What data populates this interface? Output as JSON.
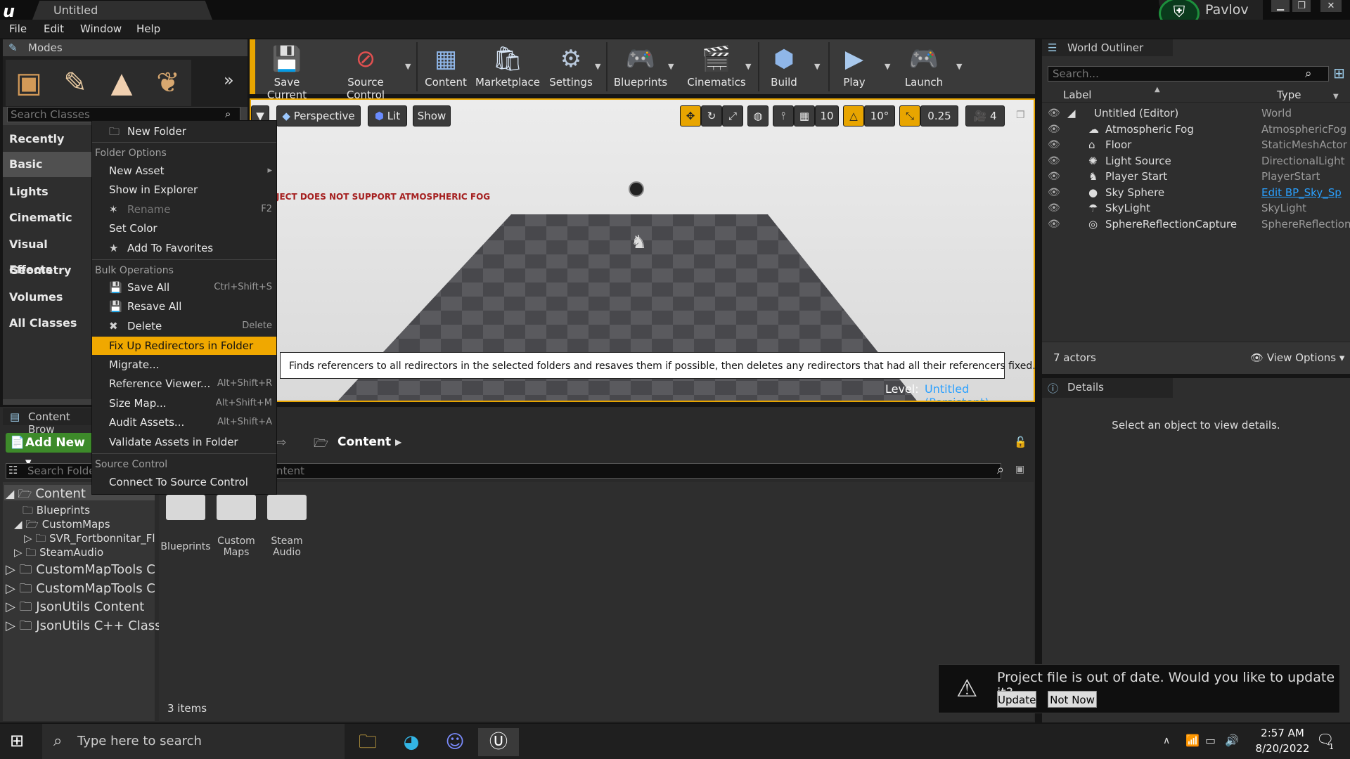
{
  "window": {
    "tab_title": "Untitled",
    "user_name": "Pavlov"
  },
  "menu": [
    "File",
    "Edit",
    "Window",
    "Help"
  ],
  "modes": {
    "tab_label": "Modes",
    "search_placeholder": "Search Classes",
    "categories": [
      "Recently Placed",
      "Basic",
      "Lights",
      "Cinematic",
      "Visual Effects",
      "Geometry",
      "Volumes",
      "All Classes"
    ]
  },
  "toolbar": {
    "buttons": [
      "Save Current",
      "Source Control",
      "Content",
      "Marketplace",
      "Settings",
      "Blueprints",
      "Cinematics",
      "Build",
      "Play",
      "Launch"
    ]
  },
  "viewport": {
    "perspective": "Perspective",
    "lit": "Lit",
    "show": "Show",
    "grid_snap": "10",
    "rot_snap": "10°",
    "scale_snap": "0.25",
    "cam_speed": "4",
    "error_text": "JECT DOES NOT SUPPORT ATMOSPHERIC FOG",
    "level_label": "Level:",
    "level_value": "Untitled (Persistent)"
  },
  "tooltip": "Finds referencers to all redirectors in the selected folders and resaves them if possible, then deletes any redirectors that had all their referencers fixed.",
  "context_menu": {
    "new_folder": "New Folder",
    "section_folder_options": "Folder Options",
    "new_asset": "New Asset",
    "show_in_explorer": "Show in Explorer",
    "rename": "Rename",
    "rename_sc": "F2",
    "set_color": "Set Color",
    "add_to_favorites": "Add To Favorites",
    "section_bulk": "Bulk Operations",
    "save_all": "Save All",
    "save_all_sc": "Ctrl+Shift+S",
    "resave_all": "Resave All",
    "delete": "Delete",
    "delete_sc": "Delete",
    "fix_up": "Fix Up Redirectors in Folder",
    "migrate": "Migrate...",
    "reference_viewer": "Reference Viewer...",
    "reference_viewer_sc": "Alt+Shift+R",
    "size_map": "Size Map...",
    "size_map_sc": "Alt+Shift+M",
    "audit_assets": "Audit Assets...",
    "audit_assets_sc": "Alt+Shift+A",
    "validate": "Validate Assets in Folder",
    "section_source_control": "Source Control",
    "connect_sc": "Connect To Source Control"
  },
  "outliner": {
    "tab_label": "World Outliner",
    "search_placeholder": "Search...",
    "col_label": "Label",
    "col_type": "Type",
    "rows": [
      {
        "label": "Untitled (Editor)",
        "type": "World"
      },
      {
        "label": "Atmospheric Fog",
        "type": "AtmosphericFog"
      },
      {
        "label": "Floor",
        "type": "StaticMeshActor"
      },
      {
        "label": "Light Source",
        "type": "DirectionalLight"
      },
      {
        "label": "Player Start",
        "type": "PlayerStart"
      },
      {
        "label": "Sky Sphere",
        "type": "Edit BP_Sky_Sp"
      },
      {
        "label": "SkyLight",
        "type": "SkyLight"
      },
      {
        "label": "SphereReflectionCapture",
        "type": "SphereReflection"
      }
    ],
    "actor_count": "7 actors",
    "view_options": "View Options"
  },
  "details": {
    "tab_label": "Details",
    "empty_text": "Select an object to view details."
  },
  "content_browser": {
    "tab_label": "Content Brow",
    "add_new": "Add New",
    "path": "Content",
    "search_folders_placeholder": "Search Folde",
    "search_assets_placeholder": "ntent",
    "tree": [
      "Content",
      "Blueprints",
      "CustomMaps",
      "SVR_Fortbonnitar_Fl",
      "SteamAudio",
      "CustomMapTools C",
      "CustomMapTools C",
      "JsonUtils Content",
      "JsonUtils C++ Class"
    ],
    "folders": [
      "Blueprints",
      "Custom\nMaps",
      "Steam\nAudio"
    ],
    "items_count": "3 items"
  },
  "update_notice": {
    "text": "Project file is out of date. Would you like to update it?",
    "update": "Update",
    "not_now": "Not Now"
  },
  "taskbar": {
    "search_placeholder": "Type here to search",
    "time": "2:57 AM",
    "date": "8/20/2022",
    "notif_count": "1"
  },
  "colors": {
    "accent": "#f0a800",
    "link": "#2aa0ff",
    "panel": "#3d3d3d"
  }
}
